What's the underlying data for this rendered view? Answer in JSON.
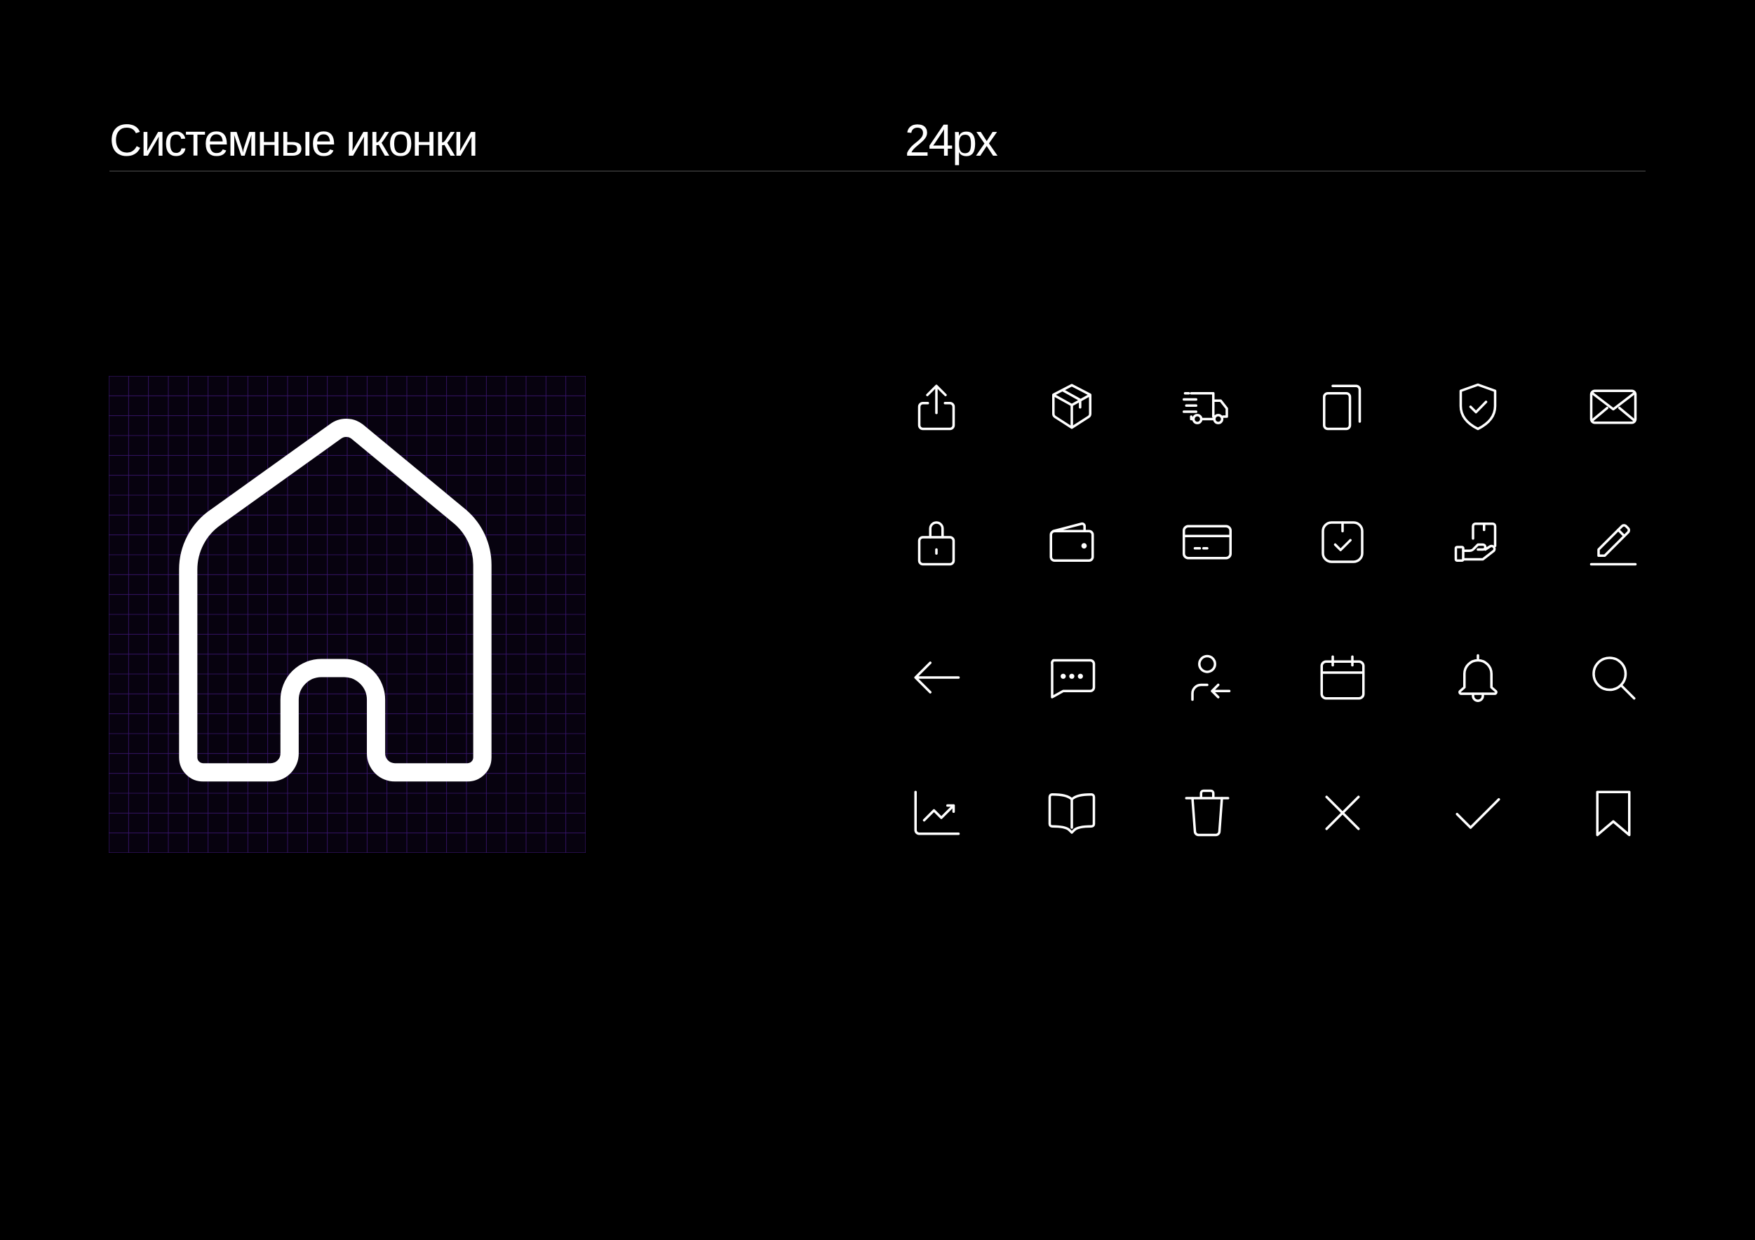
{
  "header": {
    "title": "Системные иконки",
    "size_label": "24px"
  },
  "colors": {
    "background": "#000000",
    "foreground": "#ffffff",
    "divider": "#2a2a2a",
    "grid_line": "#3b1670",
    "grid_fill": "#07020f"
  },
  "hero": {
    "icon": "home-icon",
    "grid_columns": 24,
    "grid_rows": 24
  },
  "icons": [
    "upload-icon",
    "box-icon",
    "delivery-truck-icon",
    "copy-icon",
    "shield-check-icon",
    "mail-icon",
    "lock-icon",
    "wallet-icon",
    "credit-card-icon",
    "order-check-icon",
    "hand-package-icon",
    "pencil-icon",
    "arrow-left-icon",
    "chat-icon",
    "user-transfer-icon",
    "calendar-icon",
    "bell-icon",
    "search-icon",
    "chart-icon",
    "book-icon",
    "trash-icon",
    "close-icon",
    "check-icon",
    "bookmark-icon"
  ]
}
